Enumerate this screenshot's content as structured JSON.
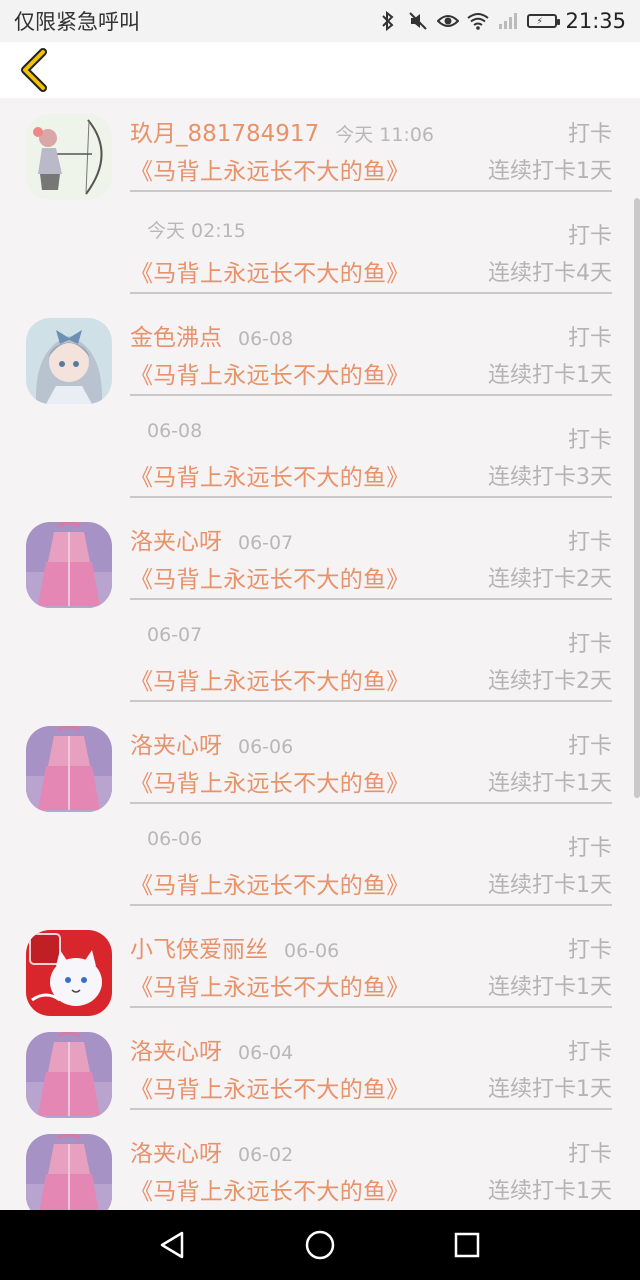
{
  "status_bar": {
    "left_text": "仅限紧急呼叫",
    "time": "21:35",
    "icons": [
      "bluetooth-icon",
      "mute-icon",
      "eye-icon",
      "wifi-icon",
      "signal-icon",
      "battery-icon"
    ]
  },
  "header": {
    "back_icon": "chevron-left-icon",
    "accent_color": "#f2c200"
  },
  "colors": {
    "accent": "#e8926a",
    "muted": "#b4b4b4",
    "background": "#f6f3f4"
  },
  "entries": [
    {
      "username": "玖月_881784917",
      "time": "今天 11:06",
      "action": "打卡",
      "book": "《马背上永远长不大的鱼》",
      "streak": "连续打卡1天",
      "avatar": "archer-avatar"
    },
    {
      "username": "",
      "time": "今天 02:15",
      "action": "打卡",
      "book": "《马背上永远长不大的鱼》",
      "streak": "连续打卡4天",
      "avatar": ""
    },
    {
      "username": "金色沸点",
      "time": "06-08",
      "action": "打卡",
      "book": "《马背上永远长不大的鱼》",
      "streak": "连续打卡1天",
      "avatar": "anime-girl-avatar"
    },
    {
      "username": "",
      "time": "06-08",
      "action": "打卡",
      "book": "《马背上永远长不大的鱼》",
      "streak": "连续打卡3天",
      "avatar": ""
    },
    {
      "username": "洛夹心呀",
      "time": "06-07",
      "action": "打卡",
      "book": "《马背上永远长不大的鱼》",
      "streak": "连续打卡2天",
      "avatar": "pink-dress-avatar"
    },
    {
      "username": "",
      "time": "06-07",
      "action": "打卡",
      "book": "《马背上永远长不大的鱼》",
      "streak": "连续打卡2天",
      "avatar": ""
    },
    {
      "username": "洛夹心呀",
      "time": "06-06",
      "action": "打卡",
      "book": "《马背上永远长不大的鱼》",
      "streak": "连续打卡1天",
      "avatar": "pink-dress-avatar"
    },
    {
      "username": "",
      "time": "06-06",
      "action": "打卡",
      "book": "《马背上永远长不大的鱼》",
      "streak": "连续打卡1天",
      "avatar": ""
    },
    {
      "username": "小飞侠爱丽丝",
      "time": "06-06",
      "action": "打卡",
      "book": "《马背上永远长不大的鱼》",
      "streak": "连续打卡1天",
      "avatar": "cola-cat-avatar"
    },
    {
      "username": "洛夹心呀",
      "time": "06-04",
      "action": "打卡",
      "book": "《马背上永远长不大的鱼》",
      "streak": "连续打卡1天",
      "avatar": "pink-dress-avatar"
    },
    {
      "username": "洛夹心呀",
      "time": "06-02",
      "action": "打卡",
      "book": "《马背上永远长不大的鱼》",
      "streak": "连续打卡1天",
      "avatar": "pink-dress-avatar"
    }
  ],
  "nav_bar": {
    "buttons": [
      "back-triangle-icon",
      "home-circle-icon",
      "recents-square-icon"
    ]
  }
}
